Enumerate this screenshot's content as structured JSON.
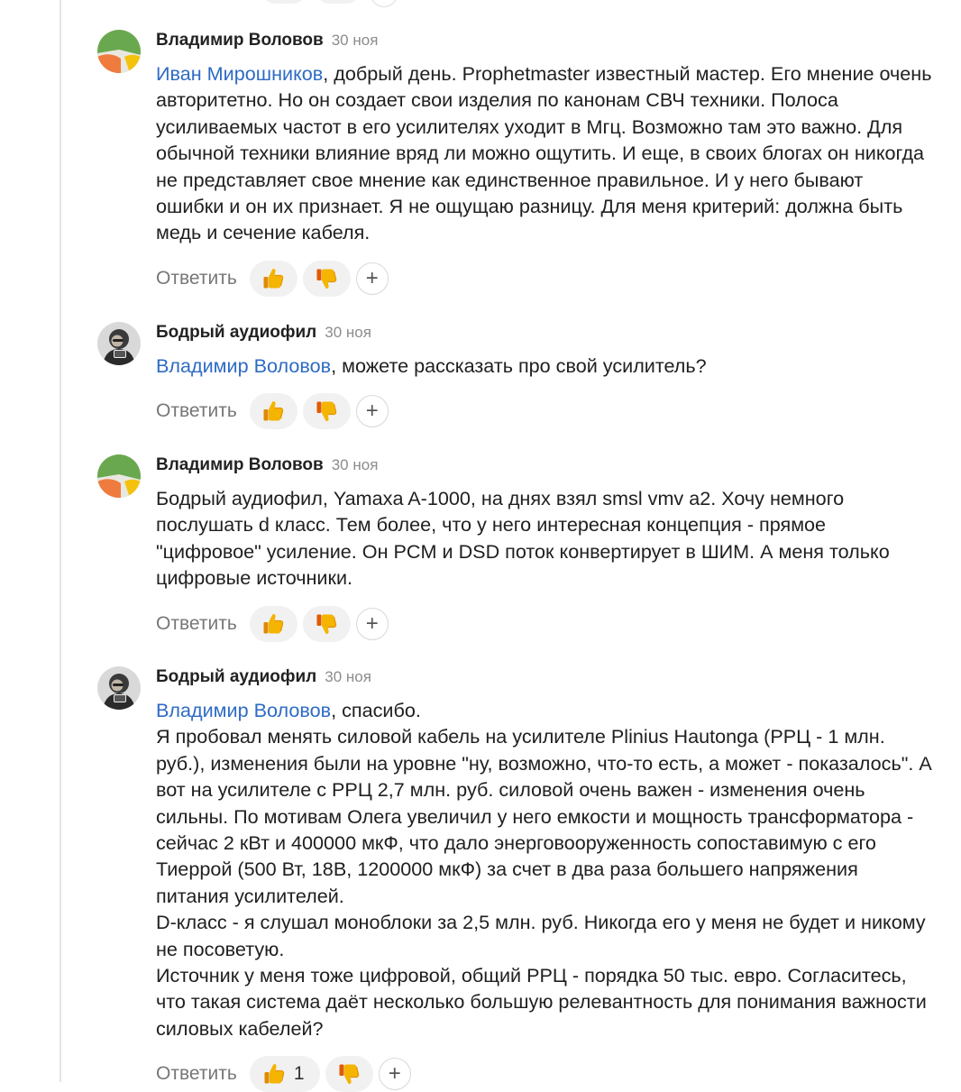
{
  "ui": {
    "reply_label": "Ответить",
    "plus_label": "+",
    "accent_color": "#2e6bc4"
  },
  "comments": [
    {
      "author": "Владимир Воловов",
      "date": "30 ноя",
      "avatar_icon": "colorful-circle-avatar",
      "mention": "Иван Мирошников",
      "text": ", добрый день. Prophetmaster известный мастер. Его мнение очень авторитетно. Но он создает свои изделия по канонам СВЧ техники. Полоса усиливаемых частот в его усилителях уходит в Мгц. Возможно там это важно. Для обычной техники влияние вряд ли можно ощутить. И еще, в своих блогах он никогда не представляет свое мнение как единственное правильное. И у него бывают ошибки и он их признает. Я не ощущаю разницу. Для меня критерий: должна быть медь и сечение кабеля.",
      "likes": ""
    },
    {
      "author": "Бодрый аудиофил",
      "date": "30 ноя",
      "avatar_icon": "photo-avatar",
      "mention": "Владимир Воловов",
      "text": ", можете рассказать про свой усилитель?",
      "likes": ""
    },
    {
      "author": "Владимир Воловов",
      "date": "30 ноя",
      "avatar_icon": "colorful-circle-avatar",
      "mention": "",
      "text": "Бодрый аудиофил, Yamaxa A-1000, на днях взял smsl vmv a2. Хочу немного послушать d класс. Тем более, что у него интересная концепция - прямое \"цифровое\" усиление. Он PCM и DSD поток конвертирует в ШИМ. А меня только цифровые источники.",
      "likes": ""
    },
    {
      "author": "Бодрый аудиофил",
      "date": "30 ноя",
      "avatar_icon": "photo-avatar",
      "mention": "Владимир Воловов",
      "text": ", спасибо.\nЯ пробовал менять силовой кабель на усилителе Plinius Hautonga (РРЦ - 1 млн. руб.), изменения были на уровне \"ну, возможно, что-то есть, а может - показалось\". А вот на усилителе с РРЦ 2,7 млн. руб. силовой очень важен - изменения очень сильны. По мотивам Олега увеличил у него емкости и мощность трансформатора - сейчас 2 кВт и 400000 мкФ, что дало энерговооруженность сопоставимую с его Тиеррой (500 Вт, 18В, 1200000 мкФ) за счет в два раза большего напряжения питания усилителей.\nD-класс - я слушал моноблоки за 2,5 млн. руб. Никогда его у меня не будет и никому не посоветую.\nИсточник у меня тоже цифровой, общий РРЦ - порядка 50 тыс. евро. Согласитесь, что такая система даёт несколько большую релевантность для понимания важности силовых кабелей?",
      "likes": "1"
    }
  ]
}
